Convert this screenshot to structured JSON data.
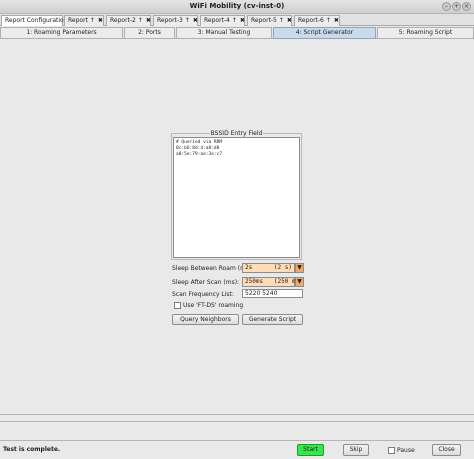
{
  "window": {
    "title": "WiFi Mobility  (cv-inst-0)",
    "controls": [
      "minimize-icon",
      "maximize-icon",
      "close-icon"
    ]
  },
  "report_tabs": [
    {
      "label": "Report Configuration",
      "closable": false
    },
    {
      "label": "Report",
      "closable": true
    },
    {
      "label": "Report-2",
      "closable": true
    },
    {
      "label": "Report-3",
      "closable": true
    },
    {
      "label": "Report-4",
      "closable": true
    },
    {
      "label": "Report-5",
      "closable": true
    },
    {
      "label": "Report-6",
      "closable": true
    }
  ],
  "sub_tabs": [
    {
      "label": "1: Roaming Parameters"
    },
    {
      "label": "2: Ports"
    },
    {
      "label": "3: Manual Testing"
    },
    {
      "label": "4: Script Generator",
      "active": true
    },
    {
      "label": "5: Roaming Script"
    }
  ],
  "bssid": {
    "group_title": "BSSID Entry Field",
    "text": "# Queried via RRM\n0c:b6:8d:4:a8:d8\na8:5e:79:ae:3e:c7"
  },
  "form": {
    "sleep_roam_label": "Sleep Between Roam (ms):",
    "sleep_roam_value": "2s      (2 s)",
    "sleep_scan_label": "Sleep After Scan (ms):",
    "sleep_scan_value": "250ms   (250 ms)",
    "scan_freq_label": "Scan Frequency List:",
    "scan_freq_value": "5220 5240",
    "ft_ds_label": "Use 'FT-DS' roaming",
    "ft_ds_checked": false,
    "query_neighbors_label": "Query Neighbors",
    "generate_script_label": "Generate Script"
  },
  "footer": {
    "status": "Test is complete.",
    "start_label": "Start",
    "skip_label": "Skip",
    "pause_label": "Pause",
    "pause_checked": false,
    "close_label": "Close"
  },
  "colors": {
    "active_subtab": "#c9daea",
    "combo_bg": "#ffdcb9",
    "combo_arrow": "#f4a861",
    "start_button": "#36e64c"
  }
}
